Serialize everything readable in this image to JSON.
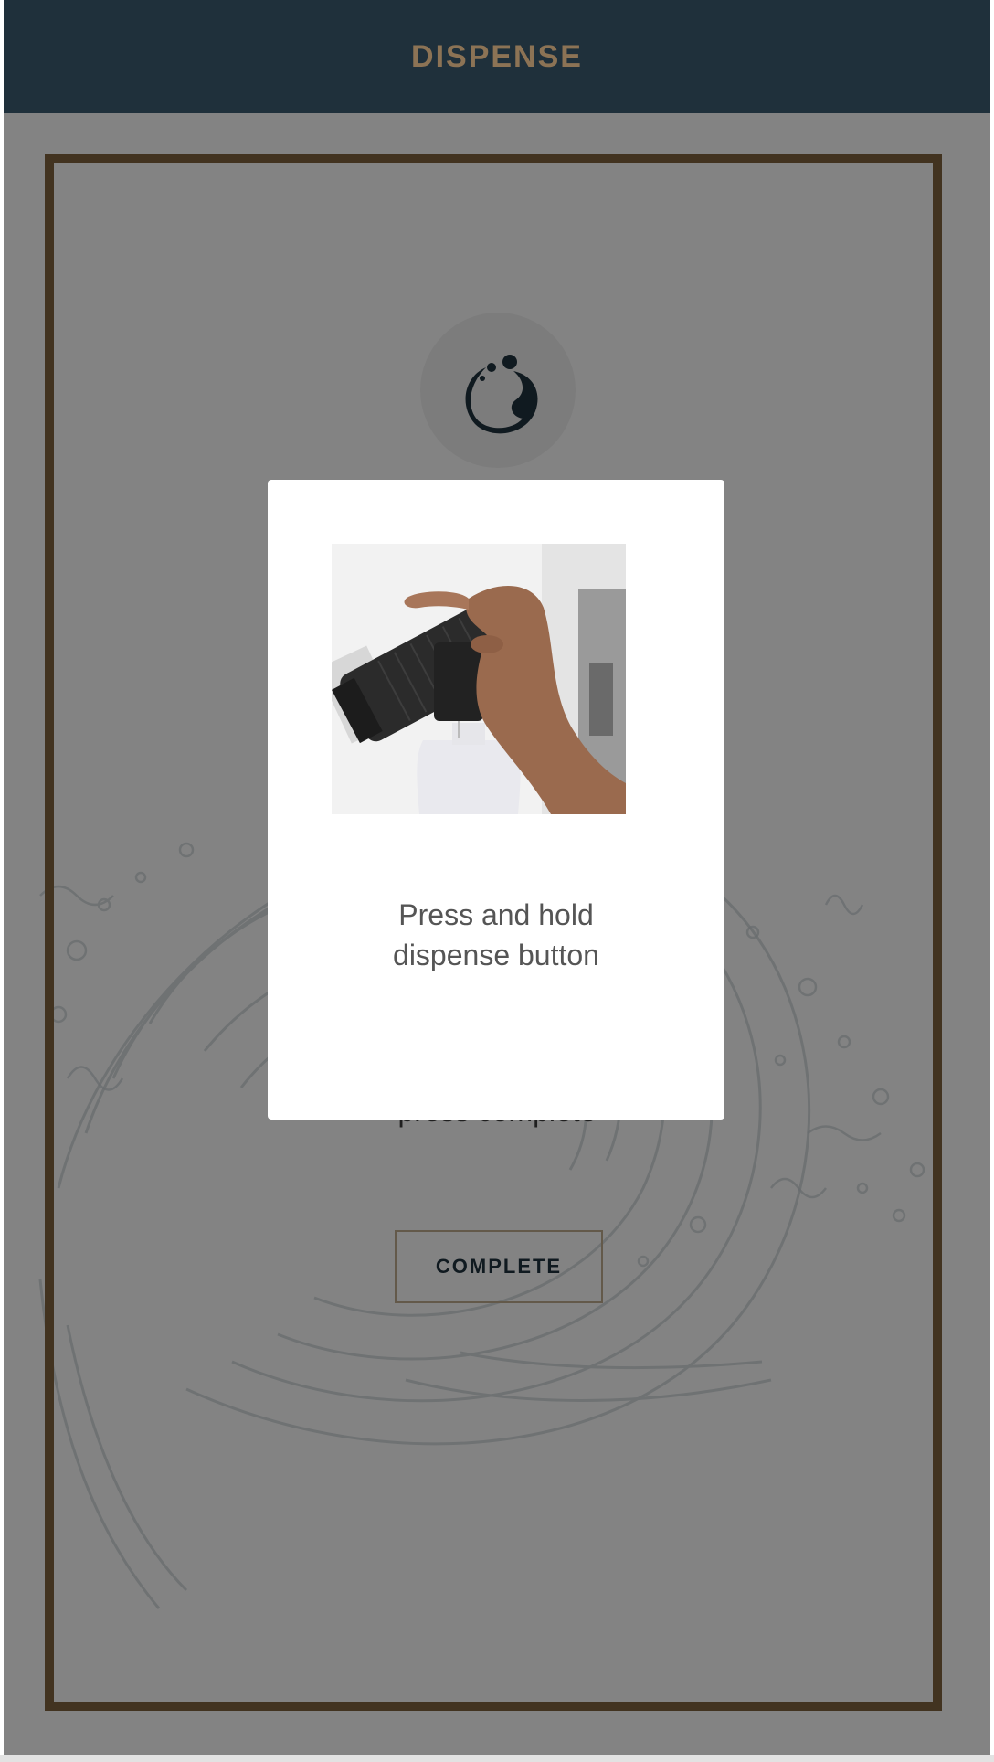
{
  "header": {
    "title": "DISPENSE"
  },
  "main": {
    "instruction_partial": "press complete",
    "complete_label": "COMPLETE"
  },
  "modal": {
    "image_icon": "dispenser-photo",
    "text_line1": "Press and hold",
    "text_line2": "dispense button"
  },
  "colors": {
    "header_bg": "#1f303b",
    "accent_brown": "#7a5e3c",
    "header_text": "#8c7355",
    "overlay": "rgba(0,0,0,0.46)"
  },
  "icons": {
    "logo": "swirl-logo-icon"
  }
}
